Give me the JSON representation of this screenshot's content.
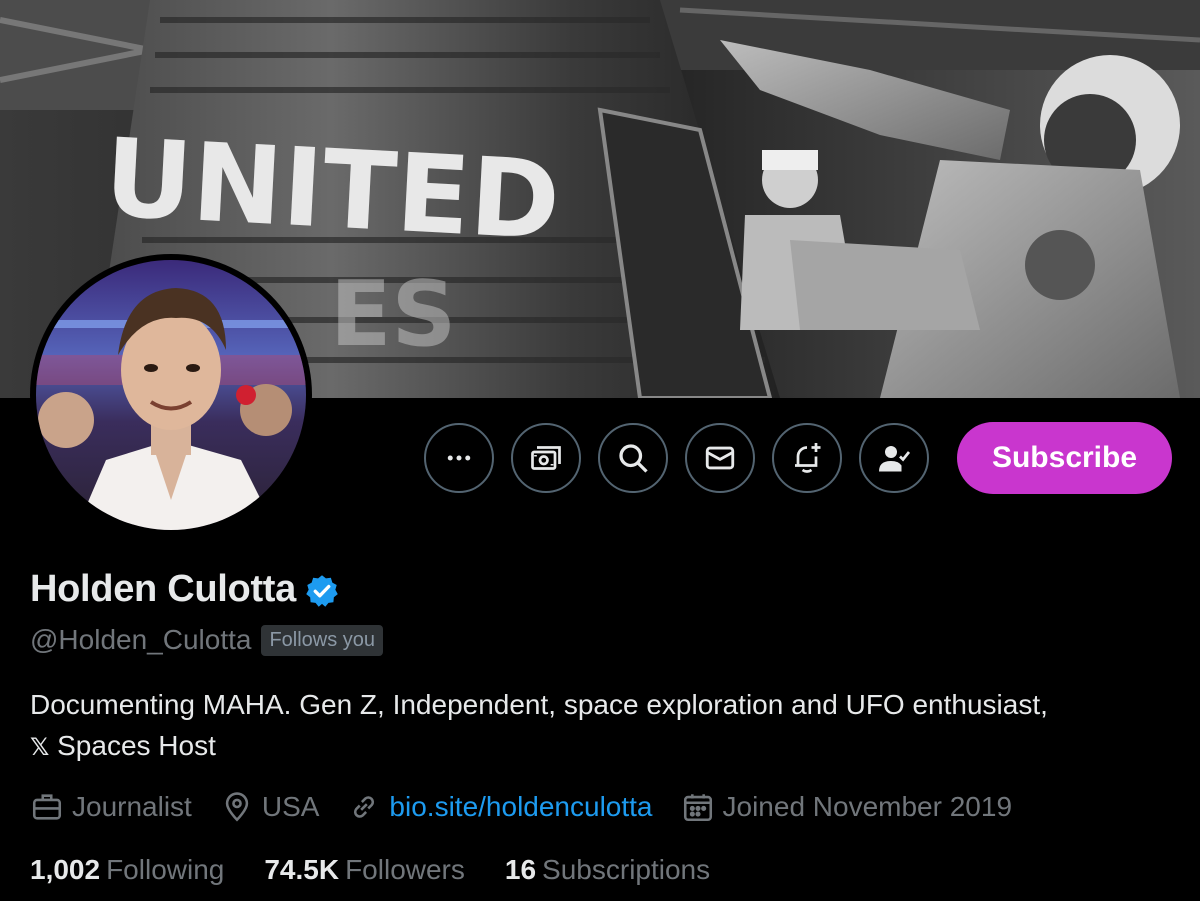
{
  "banner": {
    "capsule_text": "UNITED"
  },
  "actions": {
    "more_icon": "more-horizontal-icon",
    "tip_icon": "money-icon",
    "search_icon": "search-icon",
    "message_icon": "mail-icon",
    "notify_icon": "bell-plus-icon",
    "following_icon": "person-check-icon",
    "subscribe_label": "Subscribe"
  },
  "profile": {
    "display_name": "Holden Culotta",
    "verified_icon": "verified-badge-icon",
    "handle": "@Holden_Culotta",
    "follows_you": "Follows you",
    "bio_line1": "Documenting MAHA. Gen Z, Independent, space exploration and UFO enthusiast,",
    "bio_x": "𝕏",
    "bio_line2_rest": " Spaces Host",
    "profession": "Journalist",
    "location": "USA",
    "website": "bio.site/holdenculotta",
    "joined": "Joined November 2019",
    "following_count": "1,002",
    "following_label": "Following",
    "followers_count": "74.5K",
    "followers_label": "Followers",
    "subscriptions_count": "16",
    "subscriptions_label": "Subscriptions"
  },
  "colors": {
    "subscribe": "#c936ce",
    "link": "#1d9bf0",
    "verified": "#1d9bf0",
    "muted": "#71767b"
  }
}
